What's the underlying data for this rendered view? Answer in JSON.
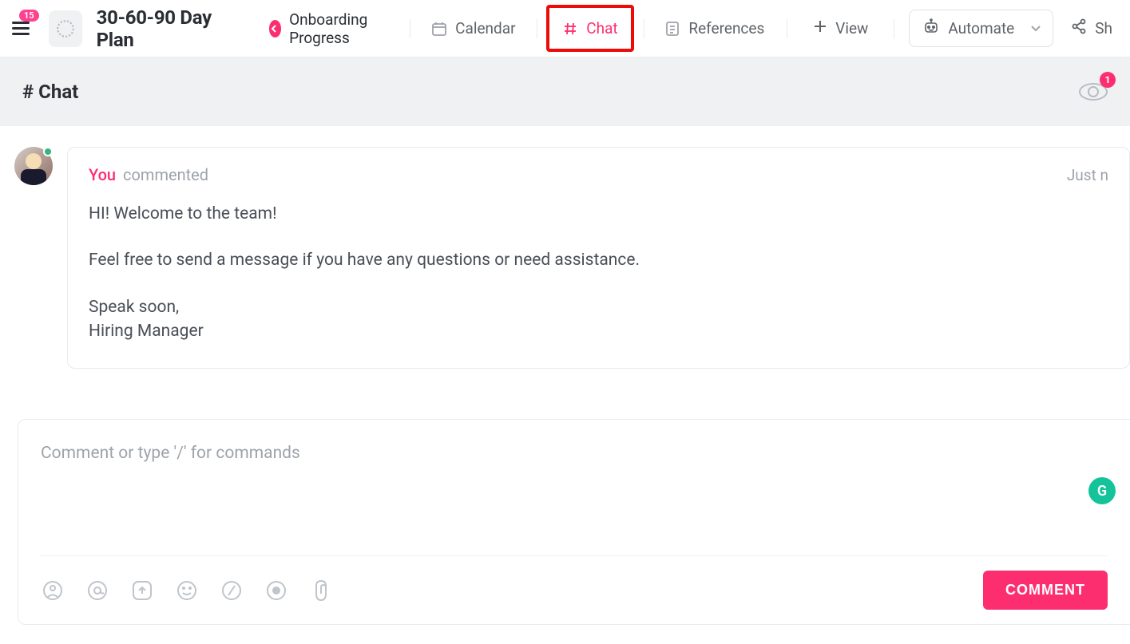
{
  "header": {
    "menu_badge": "15",
    "title": "30-60-90 Day Plan",
    "tabs": [
      {
        "label": "Onboarding Progress",
        "icon": "back"
      },
      {
        "label": "Calendar",
        "icon": "calendar"
      },
      {
        "label": "Chat",
        "icon": "hash",
        "active": true,
        "highlighted": true
      },
      {
        "label": "References",
        "icon": "doc"
      }
    ],
    "actions": {
      "view_label": "View",
      "automate_label": "Automate",
      "share_label": "Sh"
    }
  },
  "subheader": {
    "title": "# Chat",
    "watcher_count": "1"
  },
  "message": {
    "author": "You",
    "action": "commented",
    "time": "Just n",
    "body_line1": "HI! Welcome to the team!",
    "body_line2": "Feel free to send a message if you have any questions or need assistance.",
    "body_line3": "Speak soon,",
    "body_line4": "Hiring Manager"
  },
  "composer": {
    "placeholder": "Comment or type '/' for commands",
    "submit_label": "COMMENT",
    "grammarly": "G"
  }
}
